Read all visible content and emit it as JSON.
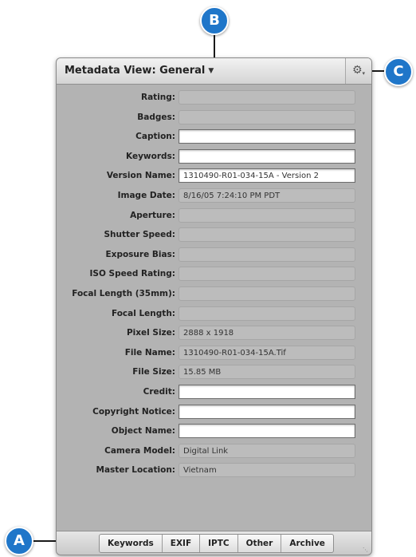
{
  "callouts": {
    "a": "A",
    "b": "B",
    "c": "C"
  },
  "header": {
    "title": "Metadata View: General",
    "dropdown_icon": "triangle-down-icon",
    "action_icon": "gear-icon"
  },
  "fields": [
    {
      "label": "Rating:",
      "value": "",
      "kind": "readonly"
    },
    {
      "label": "Badges:",
      "value": "",
      "kind": "readonly"
    },
    {
      "label": "Caption:",
      "value": "",
      "kind": "editable"
    },
    {
      "label": "Keywords:",
      "value": "",
      "kind": "editable"
    },
    {
      "label": "Version Name:",
      "value": "1310490-R01-034-15A - Version 2",
      "kind": "editable"
    },
    {
      "label": "Image Date:",
      "value": "8/16/05 7:24:10 PM PDT",
      "kind": "readonly"
    },
    {
      "label": "Aperture:",
      "value": "",
      "kind": "readonly"
    },
    {
      "label": "Shutter Speed:",
      "value": "",
      "kind": "readonly"
    },
    {
      "label": "Exposure Bias:",
      "value": "",
      "kind": "readonly"
    },
    {
      "label": "ISO Speed Rating:",
      "value": "",
      "kind": "readonly"
    },
    {
      "label": "Focal Length (35mm):",
      "value": "",
      "kind": "readonly"
    },
    {
      "label": "Focal Length:",
      "value": "",
      "kind": "readonly"
    },
    {
      "label": "Pixel Size:",
      "value": "2888 x 1918",
      "kind": "readonly"
    },
    {
      "label": "File Name:",
      "value": "1310490-R01-034-15A.Tif",
      "kind": "readonly"
    },
    {
      "label": "File Size:",
      "value": "15.85 MB",
      "kind": "readonly"
    },
    {
      "label": "Credit:",
      "value": "",
      "kind": "editable"
    },
    {
      "label": "Copyright Notice:",
      "value": "",
      "kind": "editable"
    },
    {
      "label": "Object Name:",
      "value": "",
      "kind": "editable"
    },
    {
      "label": "Camera Model:",
      "value": "Digital Link",
      "kind": "readonly"
    },
    {
      "label": "Master Location:",
      "value": "Vietnam",
      "kind": "readonly"
    }
  ],
  "tabs": [
    {
      "label": "Keywords"
    },
    {
      "label": "EXIF"
    },
    {
      "label": "IPTC"
    },
    {
      "label": "Other"
    },
    {
      "label": "Archive"
    }
  ],
  "colors": {
    "callout": "#1f76c9",
    "panel_bg": "#b3b3b3"
  }
}
